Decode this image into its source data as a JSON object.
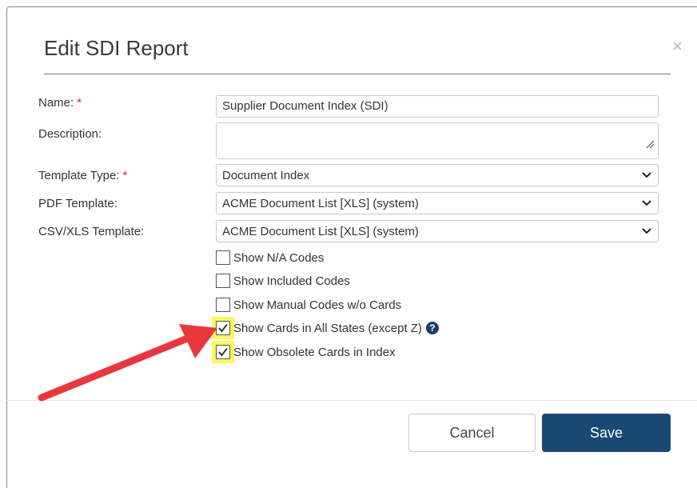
{
  "dialog": {
    "title": "Edit SDI Report",
    "close_glyph": "×"
  },
  "form": {
    "required_marker": "*",
    "name_label": "Name:",
    "name_value": "Supplier Document Index (SDI)",
    "description_label": "Description:",
    "description_value": "",
    "template_type_label": "Template Type:",
    "template_type_value": "Document Index",
    "pdf_template_label": "PDF Template:",
    "pdf_template_value": "ACME Document List [XLS] (system)",
    "csv_template_label": "CSV/XLS Template:",
    "csv_template_value": "ACME Document List [XLS] (system)"
  },
  "options": [
    {
      "label": "Show N/A Codes",
      "checked": false,
      "highlighted": false
    },
    {
      "label": "Show Included Codes",
      "checked": false,
      "highlighted": false
    },
    {
      "label": "Show Manual Codes w/o Cards",
      "checked": false,
      "highlighted": false
    },
    {
      "label": "Show Cards in All States (except Z)",
      "checked": true,
      "highlighted": true,
      "help": true
    },
    {
      "label": "Show Obsolete Cards in Index",
      "checked": true,
      "highlighted": true
    }
  ],
  "buttons": {
    "cancel": "Cancel",
    "save": "Save"
  },
  "icons": {
    "close": "close-icon",
    "chevron": "chevron-down-icon",
    "help": "question-circle-icon",
    "check": "check-icon",
    "annotation": "red-arrow-icon"
  },
  "colors": {
    "primary": "#1a4976",
    "required": "#d9232e",
    "highlight": "#fcf75e",
    "arrow": "#e8383d"
  }
}
